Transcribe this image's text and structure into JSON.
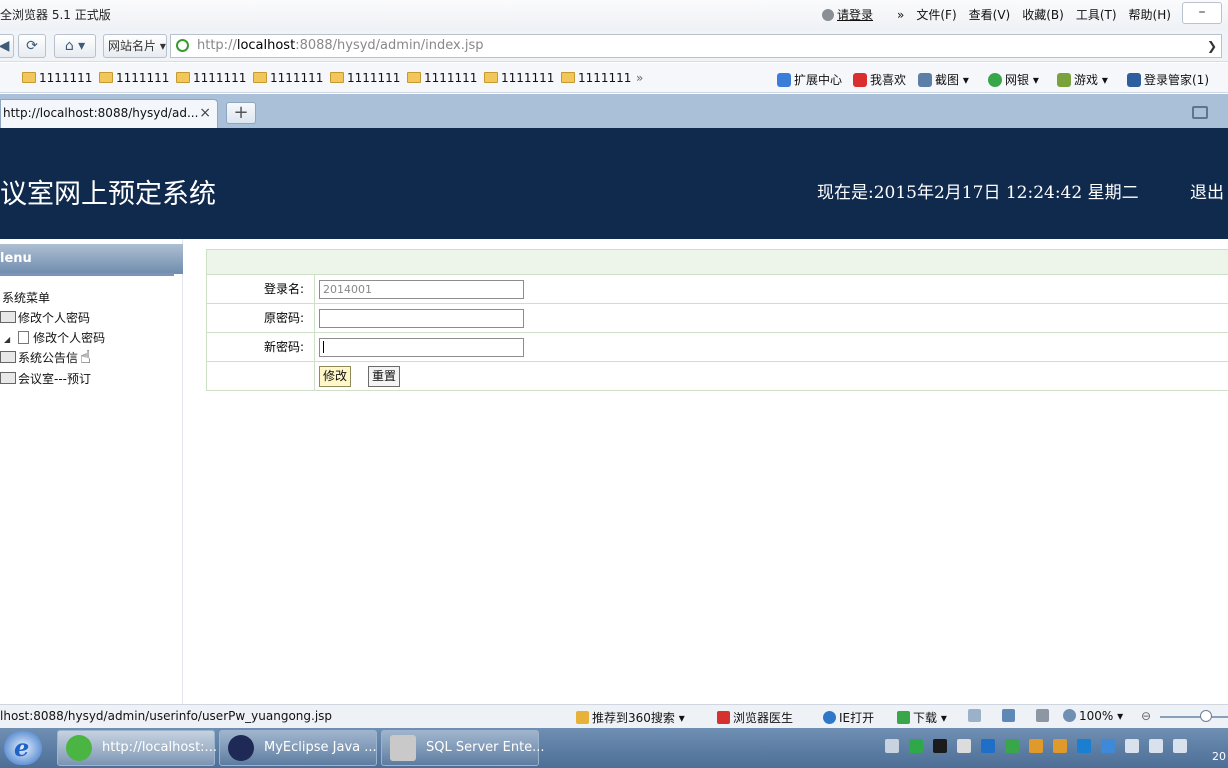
{
  "browser": {
    "app_title": "全浏览器 5.1 正式版",
    "login_label": "请登录",
    "menu_chevron": "»",
    "menus": [
      "文件(F)",
      "查看(V)",
      "收藏(B)",
      "工具(T)",
      "帮助(H)"
    ],
    "minimize_label": "–",
    "back_glyph": "◀",
    "refresh_glyph": "⟳",
    "home_glyph": "⌂ ▾",
    "site_card_label": "网站名片 ▾",
    "url_prefix": "http://",
    "url_host": "localhost",
    "url_rest": ":8088/hysyd/admin/index.jsp",
    "url_dropdown": "❯",
    "favorites": [
      "1111111",
      "1111111",
      "1111111",
      "1111111",
      "1111111",
      "1111111",
      "1111111",
      "1111111"
    ],
    "fav_overflow": "»",
    "extensions": [
      "扩展中心",
      "我喜欢",
      "截图 ▾",
      "网银 ▾",
      "游戏 ▾",
      "登录管家(1)"
    ],
    "tab_label": "http://localhost:8088/hysyd/ad...",
    "tab_close": "×",
    "new_tab": "+"
  },
  "page": {
    "site_title": "议室网上预定系统",
    "clock_text": "现在是:2015年2月17日  12:24:42 星期二",
    "logout_label": "退出",
    "menu_header": "lenu",
    "tree": {
      "root": "系统菜单",
      "items": [
        {
          "label": "修改个人密码"
        },
        {
          "label": "修改个人密码"
        },
        {
          "label": "系统公告信"
        },
        {
          "label": "会议室---预订"
        }
      ]
    },
    "cursor_glyph": "☝",
    "form": {
      "login_name_label": "登录名:",
      "login_name_value": "2014001",
      "old_password_label": "原密码:",
      "new_password_label": "新密码:",
      "submit_label": "修改",
      "reset_label": "重置"
    }
  },
  "status": {
    "url": "lhost:8088/hysyd/admin/userinfo/userPw_yuangong.jsp",
    "items": [
      "推荐到360搜索 ▾",
      "浏览器医生",
      "IE打开",
      "下载 ▾"
    ],
    "zoom": "100% ▾",
    "zoom_minus": "⊖"
  },
  "taskbar": {
    "tasks": [
      {
        "label": "http://localhost:..."
      },
      {
        "label": "MyEclipse Java ..."
      },
      {
        "label": "SQL Server Ente..."
      }
    ],
    "time_partial": "20"
  },
  "colors": {
    "header_bg": "#102a4e",
    "form_header_bg": "#edf5ea",
    "taskbar_bg": "#4d6e96"
  }
}
